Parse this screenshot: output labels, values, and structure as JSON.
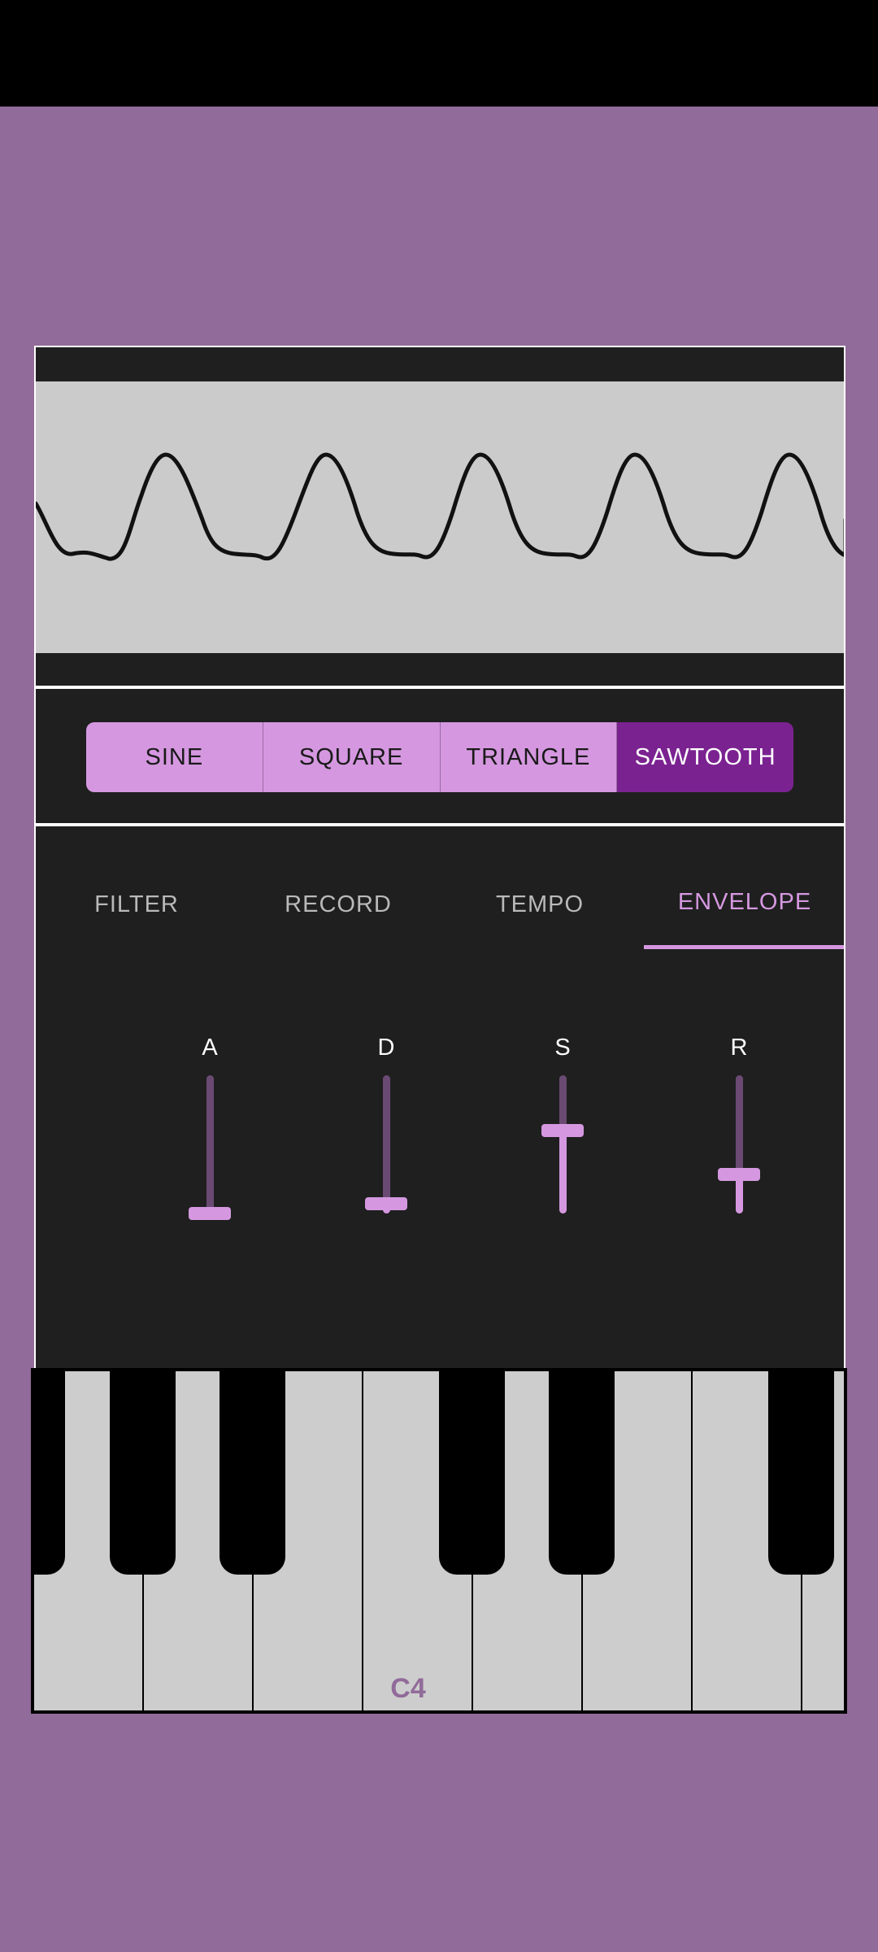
{
  "waveform_display": {
    "icon": "sawtooth-wave-plot"
  },
  "wave_selector": {
    "options": [
      "SINE",
      "SQUARE",
      "TRIANGLE",
      "SAWTOOTH"
    ],
    "selected": "SAWTOOTH"
  },
  "tabs": {
    "items": [
      "FILTER",
      "RECORD",
      "TEMPO",
      "ENVELOPE"
    ],
    "active": "ENVELOPE"
  },
  "envelope": {
    "sliders": [
      {
        "label": "A",
        "value": 0.0
      },
      {
        "label": "D",
        "value": 0.07
      },
      {
        "label": "S",
        "value": 0.6
      },
      {
        "label": "R",
        "value": 0.28
      }
    ]
  },
  "keyboard": {
    "octave_label": "C4"
  },
  "colors": {
    "background": "#916b99",
    "accent": "#d598e0",
    "selected": "#7b2291",
    "panel": "#1f1f1f"
  }
}
